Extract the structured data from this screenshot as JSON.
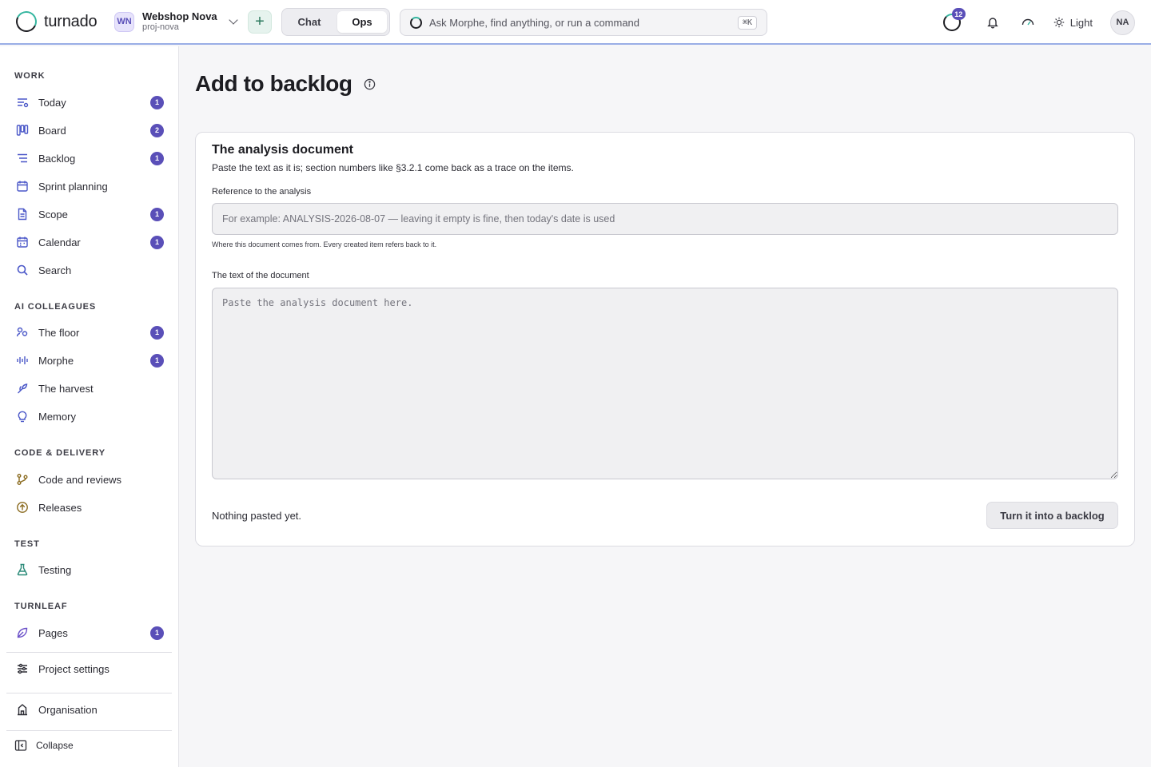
{
  "app": {
    "brand": "turnado"
  },
  "project": {
    "initials": "WN",
    "name": "Webshop Nova",
    "slug": "proj-nova"
  },
  "modes": [
    {
      "label": "Chat",
      "active": false
    },
    {
      "label": "Ops",
      "active": true
    }
  ],
  "command_bar": {
    "placeholder": "Ask Morphe, find anything, or run a command",
    "shortcut": "⌘K"
  },
  "topbar": {
    "activity_count": "12",
    "theme_label": "Light",
    "user_initials": "NA"
  },
  "colors": {
    "accent": "#5a4fb8",
    "brand_teal": "#35b6a0",
    "topbar_border": "#9aaee6"
  },
  "sidebar": {
    "groups": [
      {
        "title": "WORK",
        "items": [
          {
            "label": "Today",
            "icon": "today-icon",
            "badge": "1"
          },
          {
            "label": "Board",
            "icon": "board-icon",
            "badge": "2"
          },
          {
            "label": "Backlog",
            "icon": "backlog-icon",
            "badge": "1"
          },
          {
            "label": "Sprint planning",
            "icon": "calendar-icon",
            "badge": ""
          },
          {
            "label": "Scope",
            "icon": "document-icon",
            "badge": "1"
          },
          {
            "label": "Calendar",
            "icon": "calendar-icon",
            "badge": "1"
          },
          {
            "label": "Search",
            "icon": "search-icon",
            "badge": ""
          }
        ]
      },
      {
        "title": "AI COLLEAGUES",
        "items": [
          {
            "label": "The floor",
            "icon": "people-icon",
            "badge": "1"
          },
          {
            "label": "Morphe",
            "icon": "waveform-icon",
            "badge": "1"
          },
          {
            "label": "The harvest",
            "icon": "sprout-icon",
            "badge": ""
          },
          {
            "label": "Memory",
            "icon": "lightbulb-icon",
            "badge": ""
          }
        ]
      },
      {
        "title": "CODE & DELIVERY",
        "items": [
          {
            "label": "Code and reviews",
            "icon": "git-branch-icon",
            "badge": ""
          },
          {
            "label": "Releases",
            "icon": "release-icon",
            "badge": ""
          }
        ]
      },
      {
        "title": "TEST",
        "items": [
          {
            "label": "Testing",
            "icon": "flask-icon",
            "badge": ""
          }
        ]
      },
      {
        "title": "TURNLEAF",
        "items": [
          {
            "label": "Pages",
            "icon": "leaf-icon",
            "badge": "1"
          }
        ]
      }
    ],
    "project_settings": "Project settings",
    "organisation": "Organisation",
    "collapse": "Collapse"
  },
  "main": {
    "title": "Add to backlog",
    "card": {
      "title": "The analysis document",
      "subtitle": "Paste the text as it is; section numbers like §3.2.1 come back as a trace on the items.",
      "reference_label": "Reference to the analysis",
      "reference_placeholder": "For example: ANALYSIS-2026-08-07 — leaving it empty is fine, then today's date is used",
      "reference_value": "",
      "reference_hint": "Where this document comes from. Every created item refers back to it.",
      "text_label": "The text of the document",
      "text_placeholder": "Paste the analysis document here.",
      "text_value": "",
      "status": "Nothing pasted yet.",
      "submit": "Turn it into a backlog"
    }
  }
}
